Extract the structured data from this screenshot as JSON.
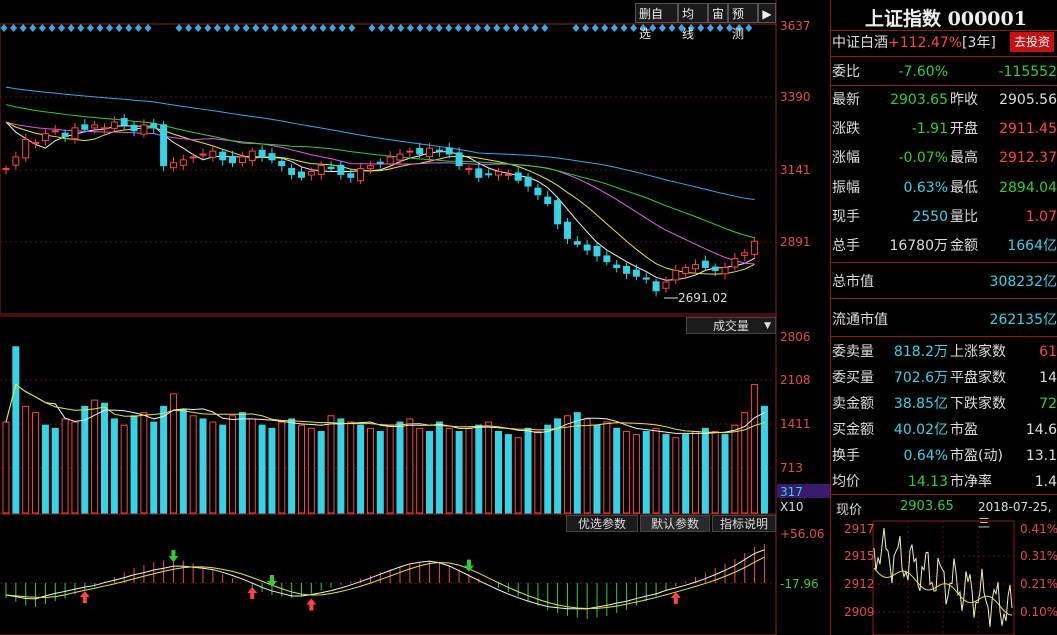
{
  "toolbar": {
    "delete_watch": "删自选",
    "avg_line": "均线",
    "cabinet": "宙",
    "forecast": "预测"
  },
  "index_title": "上证指数 000001",
  "promo": {
    "name": "中证白酒",
    "change": "+112.47%",
    "period": "[3年]",
    "button": "去投资"
  },
  "weibi": {
    "label": "委比",
    "pct": "-7.60%",
    "num": "-115552"
  },
  "quote": [
    {
      "l1": "最新",
      "v1": "2903.65",
      "c1": "g",
      "l2": "昨收",
      "v2": "2905.56",
      "c2": "w"
    },
    {
      "l1": "涨跌",
      "v1": "-1.91",
      "c1": "g",
      "l2": "开盘",
      "v2": "2911.45",
      "c2": "r"
    },
    {
      "l1": "涨幅",
      "v1": "-0.07%",
      "c1": "g",
      "l2": "最高",
      "v2": "2912.37",
      "c2": "r"
    },
    {
      "l1": "振幅",
      "v1": "0.63%",
      "c1": "c",
      "l2": "最低",
      "v2": "2894.04",
      "c2": "g"
    },
    {
      "l1": "现手",
      "v1": "2550",
      "c1": "c",
      "l2": "量比",
      "v2": "1.07",
      "c2": "r"
    },
    {
      "l1": "总手",
      "v1": "16780万",
      "c1": "w",
      "l2": "金额",
      "v2": "1664亿",
      "c2": "c"
    }
  ],
  "market": [
    {
      "label": "总市值",
      "value": "308232亿"
    },
    {
      "label": "流通市值",
      "value": "262135亿"
    }
  ],
  "stats": [
    {
      "l1": "委卖量",
      "v1": "818.2万",
      "c1": "c",
      "l2": "上涨家数",
      "v2": "61",
      "c2": "r"
    },
    {
      "l1": "委买量",
      "v1": "702.6万",
      "c1": "c",
      "l2": "平盘家数",
      "v2": "14",
      "c2": "w"
    },
    {
      "l1": "卖金额",
      "v1": "38.85亿",
      "c1": "c",
      "l2": "下跌家数",
      "v2": "72",
      "c2": "g"
    },
    {
      "l1": "买金额",
      "v1": "40.02亿",
      "c1": "c",
      "l2": "市盈",
      "v2": "14.6",
      "c2": "w"
    },
    {
      "l1": "换手",
      "v1": "0.64%",
      "c1": "c",
      "l2": "市盈(动)",
      "v2": "13.1",
      "c2": "w"
    },
    {
      "l1": "均价",
      "v1": "14.13",
      "c1": "g",
      "l2": "市净率",
      "v2": "1.4",
      "c2": "w"
    }
  ],
  "intraday": {
    "label": "现价",
    "value": "2903.65",
    "datetime": "2018-07-25,三",
    "prices": [
      "2917",
      "2915",
      "2912",
      "2909"
    ],
    "pcts": [
      "0.41%",
      "0.31%",
      "0.21%",
      "0.10%"
    ]
  },
  "volume_panel": {
    "selector": "成交量",
    "current": "317",
    "unit": "X10"
  },
  "indicator_buttons": {
    "optimize": "优选参数",
    "default": "默认参数",
    "help": "指标说明"
  },
  "chart_data": [
    {
      "type": "candlestick",
      "y_ticks": [
        "3637",
        "3390",
        "3141",
        "2891"
      ],
      "ylim": [
        2640,
        3637
      ],
      "annotation": "2691.02",
      "close_trend": [
        3140,
        3180,
        3240,
        3230,
        3260,
        3270,
        3250,
        3280,
        3275,
        3290,
        3280,
        3300,
        3290,
        3270,
        3290,
        3280,
        3150,
        3160,
        3170,
        3180,
        3190,
        3200,
        3170,
        3160,
        3180,
        3200,
        3180,
        3170,
        3150,
        3120,
        3110,
        3130,
        3150,
        3140,
        3120,
        3110,
        3140,
        3150,
        3160,
        3180,
        3190,
        3200,
        3190,
        3210,
        3200,
        3190,
        3150,
        3140,
        3110,
        3120,
        3130,
        3120,
        3100,
        3080,
        3050,
        3020,
        2950,
        2900,
        2880,
        2860,
        2840,
        2820,
        2800,
        2780,
        2770,
        2760,
        2720,
        2750,
        2790,
        2800,
        2810,
        2800,
        2790,
        2800,
        2830,
        2850,
        2890
      ]
    },
    {
      "type": "bar",
      "title": "成交量",
      "y_ticks": [
        "2806",
        "2108",
        "1411",
        "713"
      ],
      "ylim": [
        0,
        2806
      ],
      "values": [
        1450,
        2650,
        1700,
        1600,
        1400,
        1350,
        1500,
        1450,
        1700,
        1800,
        1750,
        1500,
        1400,
        1550,
        1600,
        1450,
        1700,
        1900,
        1650,
        1550,
        1500,
        1450,
        1400,
        1550,
        1600,
        1500,
        1400,
        1350,
        1450,
        1500,
        1400,
        1350,
        1300,
        1550,
        1500,
        1450,
        1400,
        1350,
        1300,
        1400,
        1450,
        1500,
        1350,
        1300,
        1450,
        1350,
        1300,
        1350,
        1400,
        1450,
        1300,
        1250,
        1200,
        1350,
        1300,
        1400,
        1500,
        1550,
        1600,
        1500,
        1400,
        1450,
        1350,
        1300,
        1250,
        1300,
        1350,
        1250,
        1200,
        1250,
        1300,
        1350,
        1300,
        1250,
        1400,
        1600,
        2050,
        1700
      ],
      "up": [
        1,
        0,
        1,
        1,
        0,
        0,
        1,
        1,
        0,
        1,
        0,
        0,
        1,
        0,
        1,
        0,
        0,
        1,
        0,
        1,
        0,
        1,
        0,
        1,
        0,
        1,
        0,
        0,
        1,
        0,
        1,
        1,
        0,
        1,
        0,
        1,
        0,
        1,
        0,
        1,
        0,
        1,
        1,
        0,
        0,
        1,
        0,
        1,
        0,
        1,
        0,
        0,
        1,
        0,
        1,
        0,
        0,
        1,
        0,
        1,
        0,
        1,
        0,
        1,
        1,
        0,
        1,
        0,
        1,
        0,
        1,
        0,
        1,
        0,
        1,
        1,
        1,
        0
      ]
    },
    {
      "type": "bar",
      "title": "MACD",
      "y_ticks": [
        "+56.06",
        "-17.96"
      ],
      "values": [
        -20,
        -25,
        -30,
        -32,
        -28,
        -24,
        -20,
        -15,
        -10,
        -5,
        2,
        8,
        14,
        20,
        24,
        28,
        30,
        32,
        30,
        26,
        22,
        18,
        12,
        6,
        0,
        -6,
        -12,
        -16,
        -18,
        -20,
        -18,
        -14,
        -10,
        -6,
        -2,
        2,
        6,
        10,
        14,
        18,
        22,
        26,
        28,
        30,
        28,
        24,
        18,
        12,
        6,
        0,
        -6,
        -12,
        -18,
        -24,
        -30,
        -36,
        -40,
        -44,
        -46,
        -48,
        -46,
        -44,
        -40,
        -36,
        -30,
        -24,
        -18,
        -10,
        -4,
        2,
        8,
        14,
        20,
        26,
        32,
        40,
        48,
        52
      ]
    }
  ]
}
